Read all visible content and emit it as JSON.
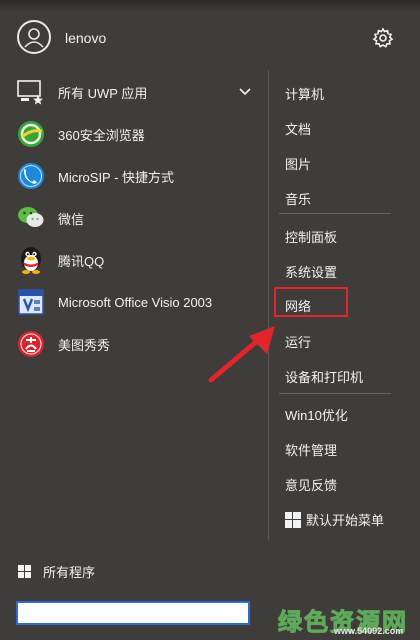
{
  "header": {
    "username": "lenovo"
  },
  "apps": [
    {
      "label": "所有 UWP 应用",
      "icon": "uwp-apps-icon"
    },
    {
      "label": "360安全浏览器",
      "icon": "browser-360-icon"
    },
    {
      "label": "MicroSIP - 快捷方式",
      "icon": "microsip-phone-icon"
    },
    {
      "label": "微信",
      "icon": "wechat-icon"
    },
    {
      "label": "腾讯QQ",
      "icon": "qq-penguin-icon"
    },
    {
      "label": "Microsoft Office Visio 2003",
      "icon": "visio-icon"
    },
    {
      "label": "美图秀秀",
      "icon": "meitu-xiuxiu-icon"
    }
  ],
  "right_menu": {
    "group1": [
      "计算机",
      "文档",
      "图片",
      "音乐"
    ],
    "group2": [
      "控制面板",
      "系统设置",
      "网络",
      "运行",
      "设备和打印机"
    ],
    "group3": [
      "Win10优化",
      "软件管理",
      "意见反馈",
      "默认开始菜单"
    ]
  },
  "highlighted_item": "网络",
  "bottom": {
    "all_programs": "所有程序",
    "search_value": ""
  },
  "watermark": {
    "main": "绿色资源网",
    "sub": "www.54092.com"
  },
  "colors": {
    "background": "#3f3c39",
    "highlight_border": "#e0262b",
    "search_border": "#2d6bd3"
  }
}
